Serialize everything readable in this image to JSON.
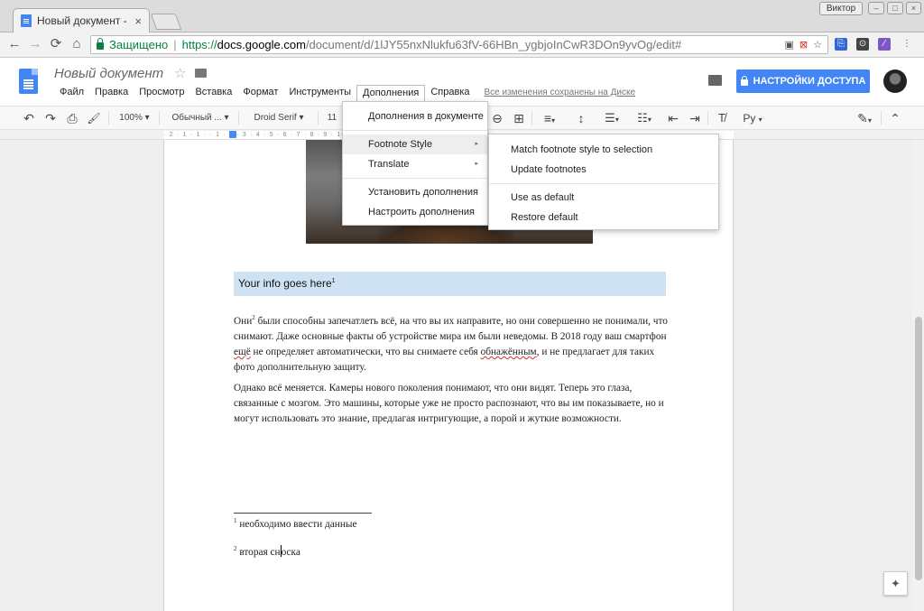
{
  "browser": {
    "tab_title": "Новый документ - Go",
    "tab_close": "×",
    "profile_name": "Виктор",
    "window_controls": {
      "minimize": "–",
      "maximize": "□",
      "close": "×"
    },
    "nav": {
      "back": "←",
      "forward": "→",
      "reload": "⟳",
      "home": "⌂"
    },
    "address": {
      "secure_label": "Защищено",
      "separator": "|",
      "scheme": "https://",
      "host": "docs.google.com",
      "path": "/document/d/1lJY55nxNlukfu63fV-66HBn_ygbjoInCwR3DOn9yvOg/edit#"
    },
    "omnibox_icons": {
      "camera": "▣",
      "popup": "⊠",
      "star": "☆"
    },
    "extension_icons": [
      {
        "name": "dict",
        "color": "#3367d6",
        "glyph": "⎘"
      },
      {
        "name": "pocket",
        "color": "#444444",
        "glyph": "⊙"
      },
      {
        "name": "pen",
        "color": "#7e57c2",
        "glyph": "∕"
      },
      {
        "name": "menu",
        "color": "#666666",
        "glyph": "⋮"
      }
    ]
  },
  "docs": {
    "title": "Новый документ",
    "star": "☆",
    "menu": [
      "Файл",
      "Правка",
      "Просмотр",
      "Вставка",
      "Формат",
      "Инструменты",
      "Дополнения",
      "Справка"
    ],
    "active_menu": "Дополнения",
    "save_status": "Все изменения сохранены на Диске",
    "share_label": "НАСТРОЙКИ ДОСТУПА"
  },
  "toolbar": {
    "undo": "↶",
    "redo": "↷",
    "print": "⎙",
    "paint_format": "🖌",
    "zoom": "100%",
    "style": "Обычный ...",
    "font": "Droid Serif",
    "font_size": "11",
    "dropdown_arrow": "▾",
    "link": "⊖",
    "insert": "⊞",
    "align": "≡",
    "line_spacing": "↕",
    "numbered_list": "☰",
    "bullet_list": "☷",
    "indent_less": "⇤",
    "indent_more": "⇥",
    "clear_format": "T̸",
    "input_tools": "Ру",
    "edit_mode": "✎",
    "collapse": "⌃"
  },
  "ruler": "· 2 · 1 · 1 ·        · 1 · 2 · 3 · 4 · 5 · 6 · 7 · 8 · 9 · 10 · 11 · 12 · 13 · 14 · 15 · 16 · 17 · 18 ·",
  "document": {
    "info_box": {
      "text": "Your info goes here",
      "sup": "1"
    },
    "paragraph1": {
      "word": "Они",
      "sup": "2",
      "text_before": " были способны запечатлеть всё, на что вы их направите, но они совершенно не понимали, что снимают. Даже основные факты об устройстве мира им были неведомы. В 2018 году ваш смартфон ",
      "misspelled1": "ещё",
      "text_middle": " не определяет автоматически, что вы снимаете себя ",
      "misspelled2": "обнажённым",
      "text_after": ", и не предлагает для таких фото дополнительную защиту."
    },
    "paragraph2": "Однако всё меняется. Камеры нового поколения понимают, что они видят. Теперь это глаза, связанные с мозгом. Это машины, которые уже не просто распознают, что вы им показываете, но и могут использовать это знание, предлагая интригующие, а порой и жуткие возможности.",
    "footnotes": [
      {
        "num": "1",
        "text": " необходимо ввести данные"
      },
      {
        "num": "2",
        "text_before": " вторая сн",
        "text_after": "оска"
      }
    ]
  },
  "addons_menu": {
    "items": [
      "Дополнения в документе",
      "Footnote Style",
      "Translate",
      "Установить дополнения",
      "Настроить дополнения"
    ],
    "submenu_arrow": "▸"
  },
  "footnote_submenu": {
    "items": [
      "Match footnote style to selection",
      "Update footnotes",
      "Use as default",
      "Restore default"
    ]
  },
  "explore_icon": "✦"
}
